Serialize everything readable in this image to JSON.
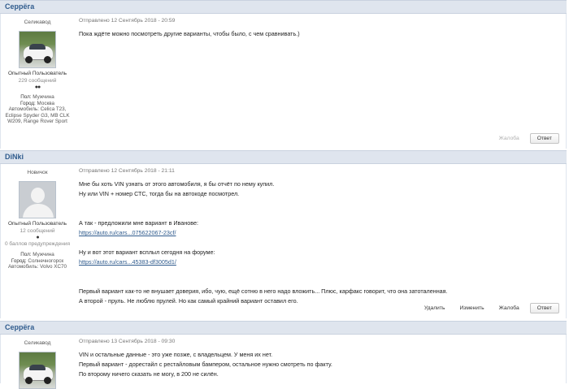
{
  "posts": [
    {
      "username": "Серрёга",
      "rank_top": "Селикавод",
      "avatar": "car-photo",
      "rank": "Опытный Пользователь",
      "post_count": "229 сообщений",
      "pips": "●●",
      "gender_label": "Пол:",
      "gender": "Мужчина",
      "city_label": "Город:",
      "city": "Москва",
      "cars_label": "Автомобиль:",
      "cars": "Celica T23, Eclipse Spyder G3, MB CLK W209, Range Rover Sport",
      "posted": "Отправлено 12 Сентябрь 2018 - 20:59",
      "lines": [
        "Пока ждёте можно посмотреть другие варианты, чтобы было, с чем сравнивать.)"
      ],
      "actions": {
        "report": "Жалоба",
        "reply": "Ответ"
      }
    },
    {
      "username": "DiNki",
      "rank_top": "Новичок",
      "avatar": "default-person",
      "rank": "Опытный Пользователь",
      "post_count": "12 сообщений",
      "warnings": "0 баллов предупреждения",
      "pips": "●",
      "gender_label": "Пол:",
      "gender": "Мужчина",
      "city_label": "Город:",
      "city": "Солнечногорск",
      "cars_label": "Автомобиль:",
      "cars": "Volvo XC70",
      "posted": "Отправлено 12 Сентябрь 2018 - 21:11",
      "lines": [
        "Мне бы хоть VIN узнать от этого автомобиля, я бы отчёт по нему купил.",
        "Ну или VIN + номер СТС, тогда бы на автокоде посмотрел.",
        "",
        "",
        "А так - предложили мне вариант в Иванове:",
        "https://auto.ru/cars...075622067-23cf/",
        "",
        "Ну и вот этот вариант всплыл сегодня на форуме:",
        "https://auto.ru/cars...45383-df3005d1/",
        "",
        "",
        "Первый вариант как-то не внушает доверия, ибо, чую, ещё сотню в него надо вложить... Плюс, карфакс говорит, что она затоталенная.",
        "А второй - пруль. Не люблю прулей. Но как самый крайний вариант оставил его."
      ],
      "actions": {
        "delete": "Удалить",
        "edit": "Изменить",
        "report": "Жалоба",
        "reply": "Ответ"
      }
    },
    {
      "username": "Серрёга",
      "rank_top": "Селикавод",
      "avatar": "car-photo",
      "posted": "Отправлено 13 Сентябрь 2018 - 09:30",
      "lines": [
        "VIN и остальные данные - это уже позже, с владельцем. У меня их нет.",
        "Первый вариант - дорестайл с рестайловым бампером, остальное нужно смотреть по факту.",
        "По второму ничего сказать не могу, в 200 не силён."
      ]
    }
  ]
}
